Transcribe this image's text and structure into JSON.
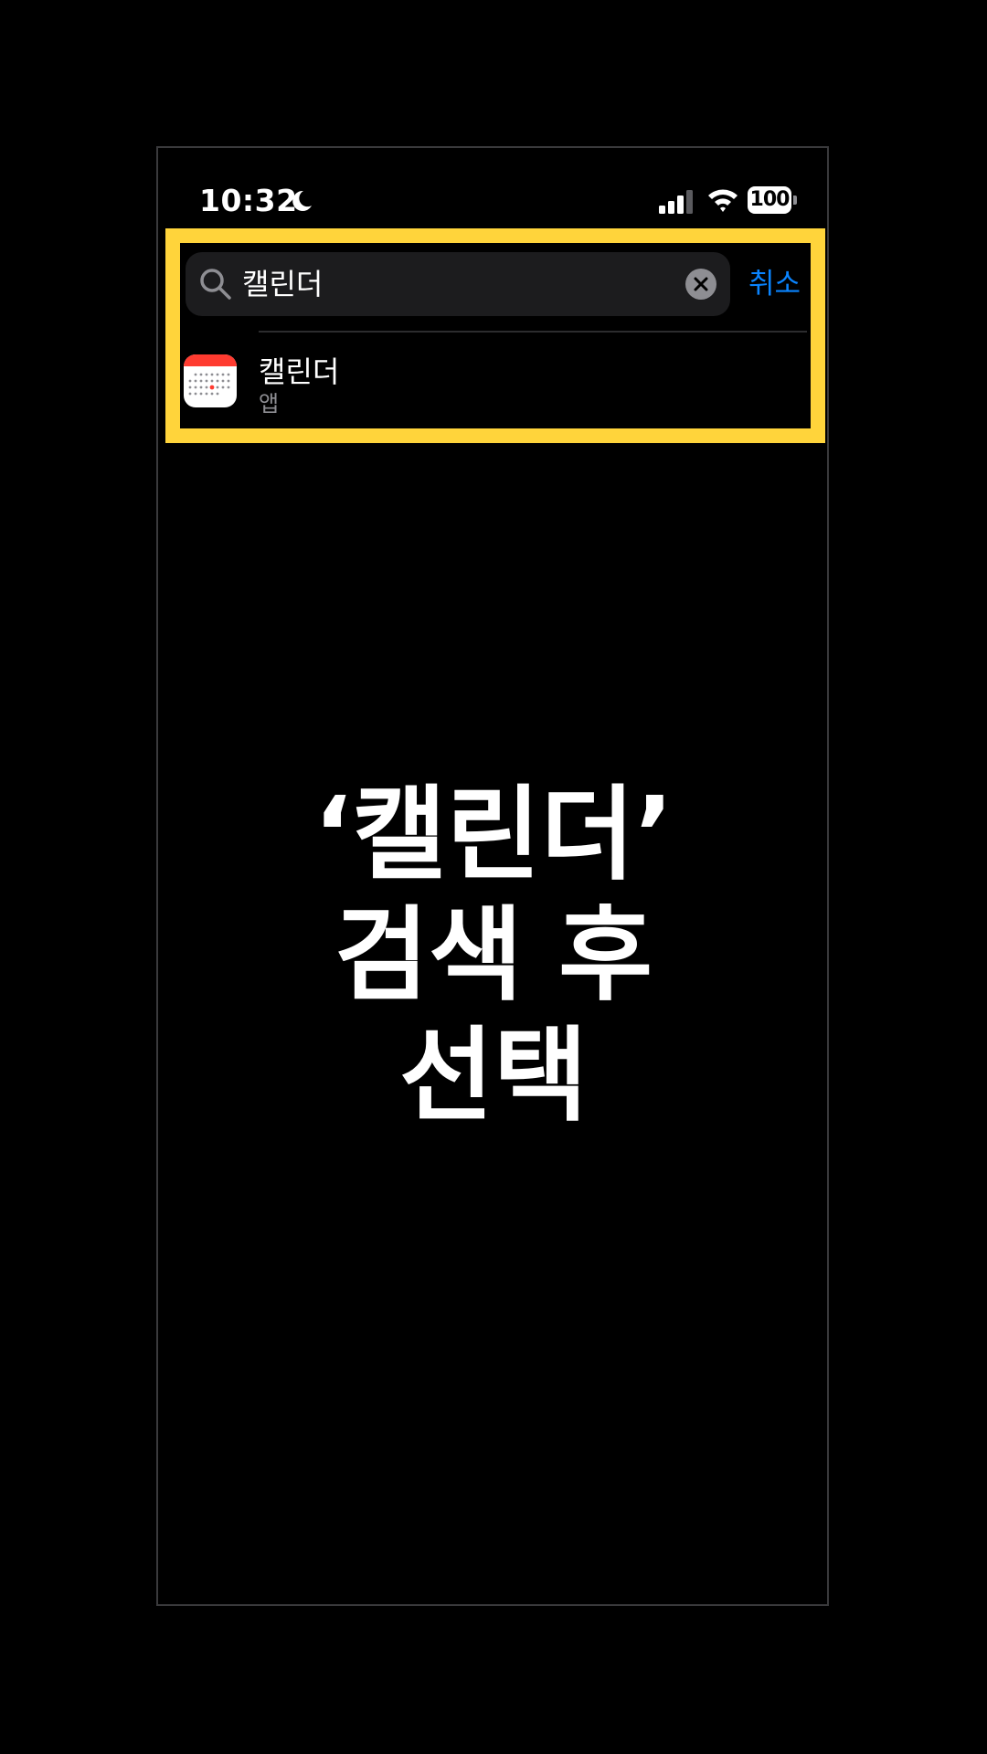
{
  "status_bar": {
    "time": "10:32",
    "battery": "100",
    "icons": [
      "moon-icon",
      "signal-icon",
      "wifi-icon",
      "battery-icon"
    ]
  },
  "search": {
    "query": "캘린더",
    "cancel_label": "취소",
    "icons": [
      "search-icon",
      "clear-icon"
    ]
  },
  "results": [
    {
      "title": "캘린더",
      "subtitle": "앱",
      "icon": "calendar-app-icon"
    }
  ],
  "caption": {
    "lines": [
      "‘캘린더’",
      "검색 후",
      "선택"
    ]
  },
  "colors": {
    "background": "#000000",
    "highlight": "#ffd43b",
    "accent": "#0a84ff",
    "search_field": "#1c1c1e",
    "secondary_text": "#8e8e93"
  }
}
